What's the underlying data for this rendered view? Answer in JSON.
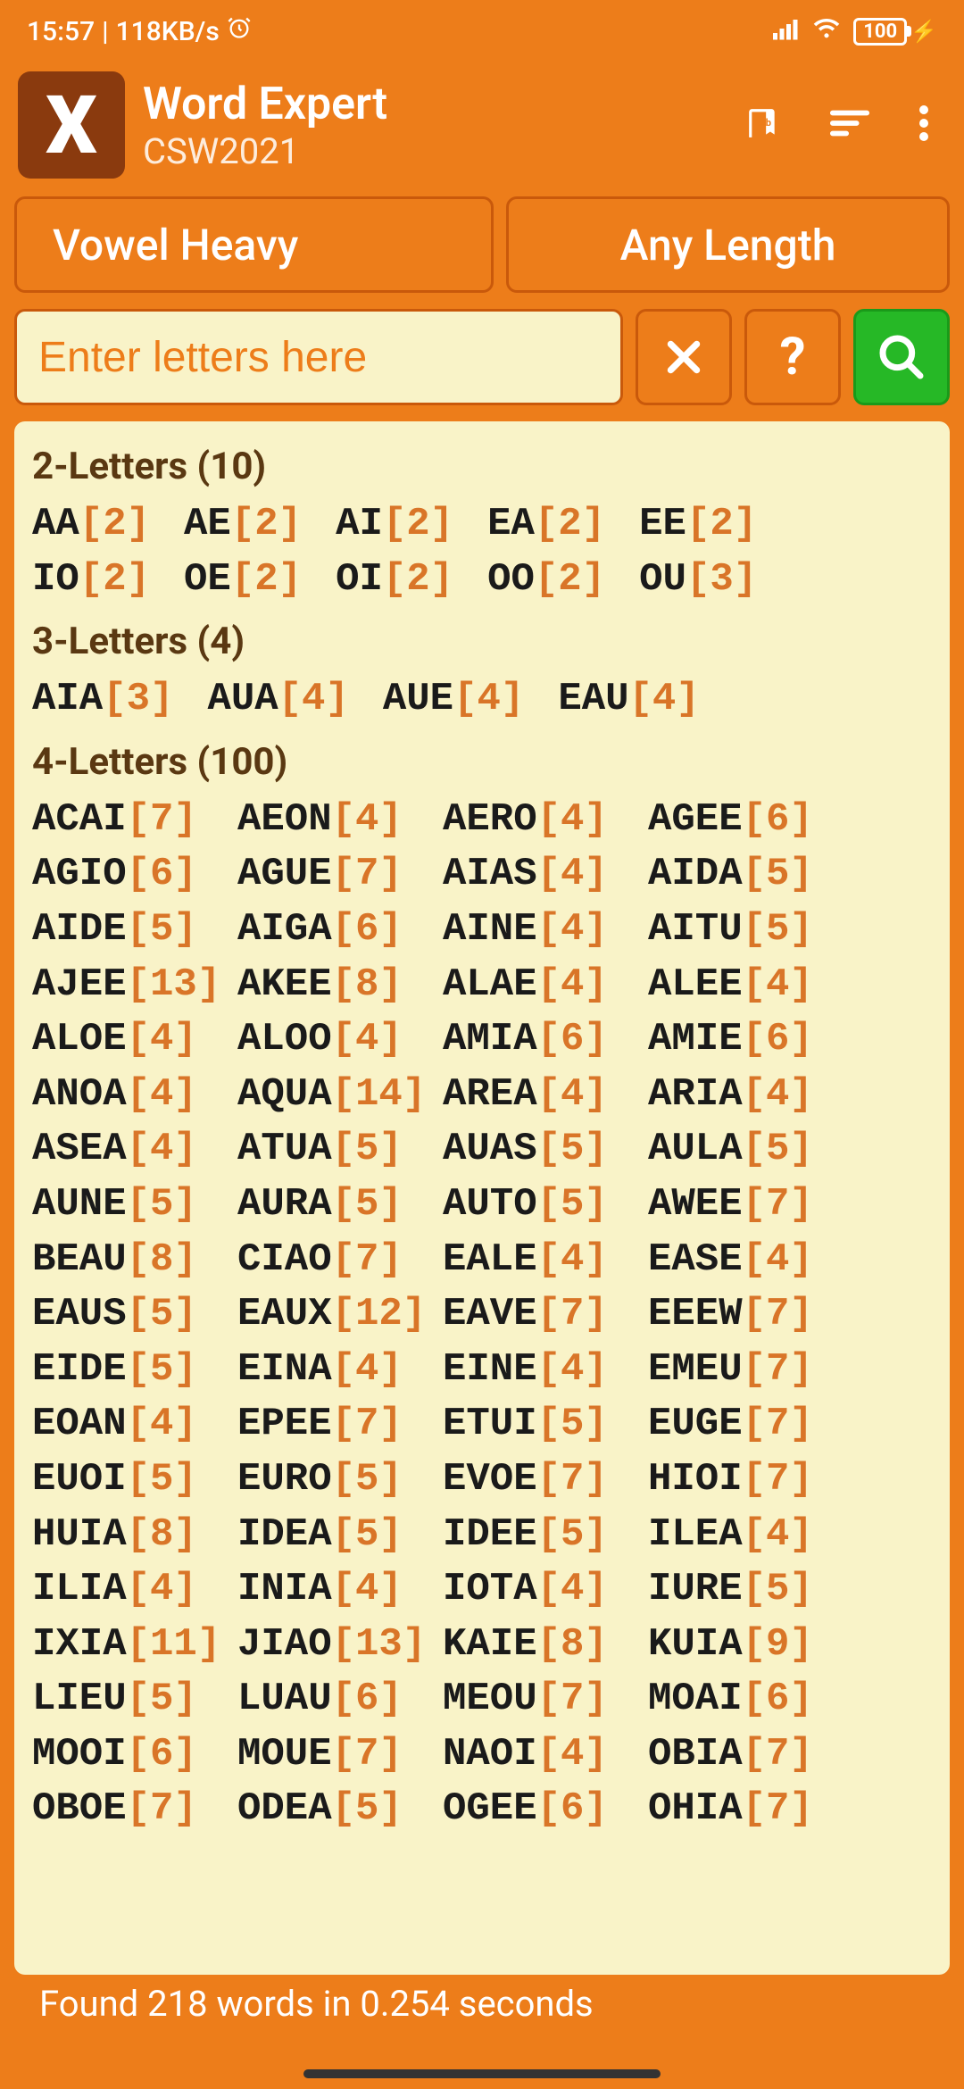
{
  "status": {
    "time": "15:57",
    "speed": "118KB/s",
    "battery": "100"
  },
  "header": {
    "icon_letter": "X",
    "title": "Word Expert",
    "subtitle": "CSW2021"
  },
  "filters": {
    "word_type": "Vowel Heavy",
    "length": "Any Length"
  },
  "search": {
    "placeholder": "Enter letters here"
  },
  "sections": [
    {
      "title": "2-Letters (10)",
      "cols": 5,
      "words": [
        {
          "w": "AA",
          "s": 2
        },
        {
          "w": "AE",
          "s": 2
        },
        {
          "w": "AI",
          "s": 2
        },
        {
          "w": "EA",
          "s": 2
        },
        {
          "w": "EE",
          "s": 2
        },
        {
          "w": "IO",
          "s": 2
        },
        {
          "w": "OE",
          "s": 2
        },
        {
          "w": "OI",
          "s": 2
        },
        {
          "w": "OO",
          "s": 2
        },
        {
          "w": "OU",
          "s": 3
        }
      ]
    },
    {
      "title": "3-Letters (4)",
      "cols": 4,
      "words": [
        {
          "w": "AIA",
          "s": 3
        },
        {
          "w": "AUA",
          "s": 4
        },
        {
          "w": "AUE",
          "s": 4
        },
        {
          "w": "EAU",
          "s": 4
        }
      ]
    },
    {
      "title": "4-Letters (100)",
      "cols": 4,
      "words": [
        {
          "w": "ACAI",
          "s": 7
        },
        {
          "w": "AEON",
          "s": 4
        },
        {
          "w": "AERO",
          "s": 4
        },
        {
          "w": "AGEE",
          "s": 6
        },
        {
          "w": "AGIO",
          "s": 6
        },
        {
          "w": "AGUE",
          "s": 7
        },
        {
          "w": "AIAS",
          "s": 4
        },
        {
          "w": "AIDA",
          "s": 5
        },
        {
          "w": "AIDE",
          "s": 5
        },
        {
          "w": "AIGA",
          "s": 6
        },
        {
          "w": "AINE",
          "s": 4
        },
        {
          "w": "AITU",
          "s": 5
        },
        {
          "w": "AJEE",
          "s": 13
        },
        {
          "w": "AKEE",
          "s": 8
        },
        {
          "w": "ALAE",
          "s": 4
        },
        {
          "w": "ALEE",
          "s": 4
        },
        {
          "w": "ALOE",
          "s": 4
        },
        {
          "w": "ALOO",
          "s": 4
        },
        {
          "w": "AMIA",
          "s": 6
        },
        {
          "w": "AMIE",
          "s": 6
        },
        {
          "w": "ANOA",
          "s": 4
        },
        {
          "w": "AQUA",
          "s": 14
        },
        {
          "w": "AREA",
          "s": 4
        },
        {
          "w": "ARIA",
          "s": 4
        },
        {
          "w": "ASEA",
          "s": 4
        },
        {
          "w": "ATUA",
          "s": 5
        },
        {
          "w": "AUAS",
          "s": 5
        },
        {
          "w": "AULA",
          "s": 5
        },
        {
          "w": "AUNE",
          "s": 5
        },
        {
          "w": "AURA",
          "s": 5
        },
        {
          "w": "AUTO",
          "s": 5
        },
        {
          "w": "AWEE",
          "s": 7
        },
        {
          "w": "BEAU",
          "s": 8
        },
        {
          "w": "CIAO",
          "s": 7
        },
        {
          "w": "EALE",
          "s": 4
        },
        {
          "w": "EASE",
          "s": 4
        },
        {
          "w": "EAUS",
          "s": 5
        },
        {
          "w": "EAUX",
          "s": 12
        },
        {
          "w": "EAVE",
          "s": 7
        },
        {
          "w": "EEEW",
          "s": 7
        },
        {
          "w": "EIDE",
          "s": 5
        },
        {
          "w": "EINA",
          "s": 4
        },
        {
          "w": "EINE",
          "s": 4
        },
        {
          "w": "EMEU",
          "s": 7
        },
        {
          "w": "EOAN",
          "s": 4
        },
        {
          "w": "EPEE",
          "s": 7
        },
        {
          "w": "ETUI",
          "s": 5
        },
        {
          "w": "EUGE",
          "s": 7
        },
        {
          "w": "EUOI",
          "s": 5
        },
        {
          "w": "EURO",
          "s": 5
        },
        {
          "w": "EVOE",
          "s": 7
        },
        {
          "w": "HIOI",
          "s": 7
        },
        {
          "w": "HUIA",
          "s": 8
        },
        {
          "w": "IDEA",
          "s": 5
        },
        {
          "w": "IDEE",
          "s": 5
        },
        {
          "w": "ILEA",
          "s": 4
        },
        {
          "w": "ILIA",
          "s": 4
        },
        {
          "w": "INIA",
          "s": 4
        },
        {
          "w": "IOTA",
          "s": 4
        },
        {
          "w": "IURE",
          "s": 5
        },
        {
          "w": "IXIA",
          "s": 11
        },
        {
          "w": "JIAO",
          "s": 13
        },
        {
          "w": "KAIE",
          "s": 8
        },
        {
          "w": "KUIA",
          "s": 9
        },
        {
          "w": "LIEU",
          "s": 5
        },
        {
          "w": "LUAU",
          "s": 6
        },
        {
          "w": "MEOU",
          "s": 7
        },
        {
          "w": "MOAI",
          "s": 6
        },
        {
          "w": "MOOI",
          "s": 6
        },
        {
          "w": "MOUE",
          "s": 7
        },
        {
          "w": "NAOI",
          "s": 4
        },
        {
          "w": "OBIA",
          "s": 7
        },
        {
          "w": "OBOE",
          "s": 7
        },
        {
          "w": "ODEA",
          "s": 5
        },
        {
          "w": "OGEE",
          "s": 6
        },
        {
          "w": "OHIA",
          "s": 7
        }
      ]
    }
  ],
  "footer": "Found 218 words in 0.254 seconds"
}
